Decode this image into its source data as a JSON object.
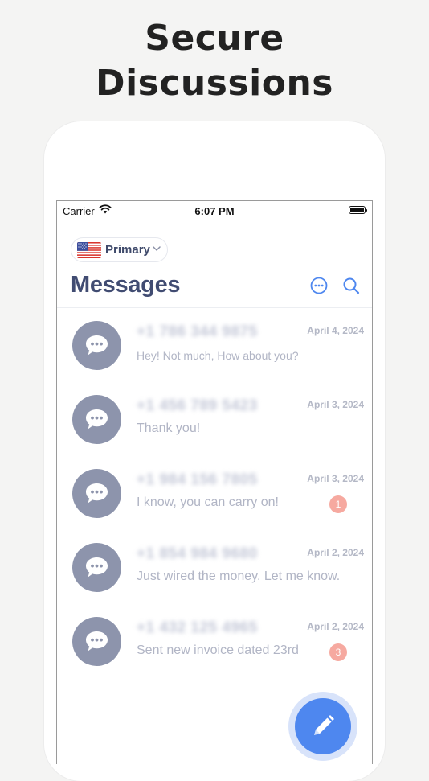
{
  "headline": {
    "line1": "Secure",
    "line2": "Discussions"
  },
  "status_bar": {
    "carrier": "Carrier",
    "time": "6:07 PM"
  },
  "account_selector": {
    "flag": "us-flag",
    "label": "Primary"
  },
  "header": {
    "title": "Messages"
  },
  "messages": [
    {
      "number": "+1 786 344 9875",
      "date": "April 4, 2024",
      "preview": "Hey! Not much, How about you?",
      "unread": ""
    },
    {
      "number": "+1 456 789 5423",
      "date": "April 3, 2024",
      "preview": "Thank you!",
      "unread": ""
    },
    {
      "number": "+1 984 156 7805",
      "date": "April 3, 2024",
      "preview": "I know, you can carry on!",
      "unread": "1"
    },
    {
      "number": "+1 854 984 9680",
      "date": "April 2, 2024",
      "preview": "Just wired the money. Let me know.",
      "unread": ""
    },
    {
      "number": "+1 432 125 4965",
      "date": "April 2, 2024",
      "preview": "Sent new invoice dated 23rd",
      "unread": "3"
    }
  ],
  "colors": {
    "accent": "#4e87ef",
    "title": "#414c72",
    "avatar": "#8d94ac",
    "badge": "#f6a9a0"
  },
  "icons": {
    "more": "more-horizontal-circle-icon",
    "search": "search-icon",
    "avatar": "chat-bubble-icon",
    "compose": "pencil-icon"
  }
}
